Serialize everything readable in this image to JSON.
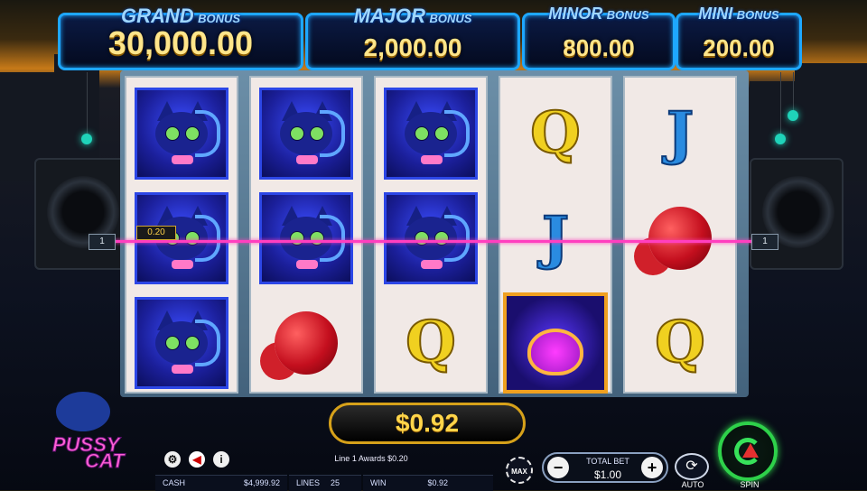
{
  "jackpots": [
    {
      "title_main": "GRAND",
      "title_sub": "BONUS",
      "value": "30,000.00"
    },
    {
      "title_main": "MAJOR",
      "title_sub": "BONUS",
      "value": "2,000.00"
    },
    {
      "title_main": "MINOR",
      "title_sub": "BONUS",
      "value": "800.00"
    },
    {
      "title_main": "MINI",
      "title_sub": "BONUS",
      "value": "200.00"
    }
  ],
  "reels": [
    [
      "cat",
      "cat",
      "cat"
    ],
    [
      "cat",
      "cat",
      "yarn"
    ],
    [
      "cat",
      "cat",
      "Q"
    ],
    [
      "Q",
      "J",
      "paw"
    ],
    [
      "J",
      "yarn",
      "Q"
    ]
  ],
  "payline": {
    "number_left": "1",
    "number_right": "1",
    "win_tag": "0.20",
    "color": "#ff3fbf"
  },
  "win_amount": "$0.92",
  "message": "Line 1 Awards $0.20",
  "logo": {
    "line1": "PUSSY",
    "line2": "CAT"
  },
  "stats": {
    "cash_label": "CASH",
    "cash_value": "$4,999.92",
    "lines_label": "LINES",
    "lines_value": "25",
    "win_label": "WIN",
    "win_value": "$0.92"
  },
  "controls": {
    "max_label": "MAX",
    "total_bet_label": "TOTAL BET",
    "total_bet_value": "$1.00",
    "minus_label": "−",
    "plus_label": "+",
    "auto_label": "AUTO",
    "spin_label": "SPIN",
    "settings_icon": "gear-icon",
    "sound_icon": "sound-off-icon",
    "info_icon": "info-icon"
  },
  "colors": {
    "accent_blue": "#1ea7ff",
    "gold": "#ffd54a",
    "spin_green": "#2ed14a"
  }
}
